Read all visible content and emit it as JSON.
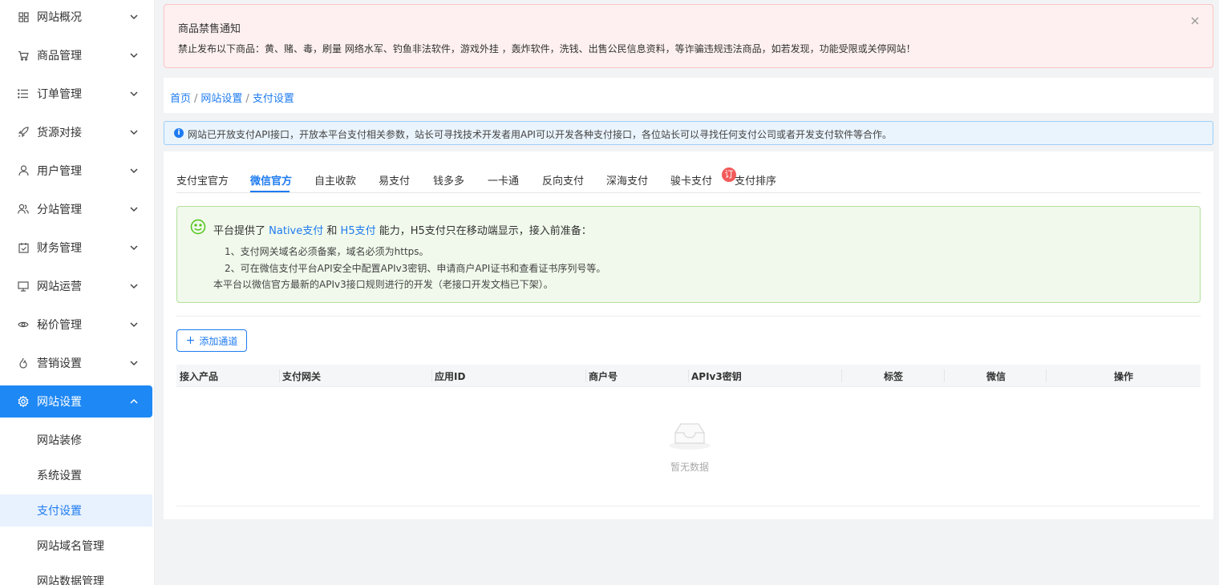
{
  "sidebar": {
    "items": [
      {
        "label": "网站概况",
        "icon": "grid-icon"
      },
      {
        "label": "商品管理",
        "icon": "cart-icon"
      },
      {
        "label": "订单管理",
        "icon": "list-icon"
      },
      {
        "label": "货源对接",
        "icon": "rocket-icon"
      },
      {
        "label": "用户管理",
        "icon": "user-icon"
      },
      {
        "label": "分站管理",
        "icon": "users-icon"
      },
      {
        "label": "财务管理",
        "icon": "calendar-icon"
      },
      {
        "label": "网站运营",
        "icon": "monitor-icon"
      },
      {
        "label": "秘价管理",
        "icon": "eye-icon"
      },
      {
        "label": "营销设置",
        "icon": "flame-icon"
      },
      {
        "label": "网站设置",
        "icon": "gear-icon"
      }
    ],
    "subitems": [
      "网站装修",
      "系统设置",
      "支付设置",
      "网站域名管理",
      "网站数据管理"
    ]
  },
  "notice": {
    "title": "商品禁售通知",
    "text": "禁止发布以下商品：黄、赌、毒，刷量 网络水军、钓鱼非法软件，游戏外挂 ，轰炸软件，洗钱、出售公民信息资料，等诈骗违规违法商品，如若发现，功能受限或关停网站！"
  },
  "breadcrumb": {
    "home": "首页",
    "settings": "网站设置",
    "current": "支付设置",
    "sep": "/"
  },
  "info": {
    "text": "网站已开放支付API接口，开放本平台支付相关参数，站长可寻找技术开发者用API可以开发各种支付接口，各位站长可以寻找任何支付公司或者开发支付软件等合作。"
  },
  "tabs": [
    "支付宝官方",
    "微信官方",
    "自主收款",
    "易支付",
    "钱多多",
    "一卡通",
    "反向支付",
    "深海支付",
    "骏卡支付",
    "支付排序"
  ],
  "tab_badge": "订",
  "alert": {
    "pre": "平台提供了",
    "native": "Native支付",
    "and": "和",
    "h5": "H5支付",
    "post": "能力，H5支付只在移动端显示，接入前准备：",
    "lines": [
      "1、支付网关域名必须备案，域名必须为https。",
      "2、可在微信支付平台API安全中配置APIv3密钥、申请商户API证书和查看证书序列号等。",
      "本平台以微信官方最新的APIv3接口规则进行的开发（老接口开发文档已下架）。"
    ]
  },
  "add_button": "添加通道",
  "table": {
    "headers": [
      "接入产品",
      "支付网关",
      "应用ID",
      "商户号",
      "APIv3密钥",
      "标签",
      "微信",
      "操作"
    ],
    "empty": "暂无数据"
  },
  "colors": {
    "primary": "#1e88f5",
    "danger_bg": "#fef0f0",
    "success_bg": "#f0f9eb",
    "info_bg": "#eaf4fd"
  }
}
